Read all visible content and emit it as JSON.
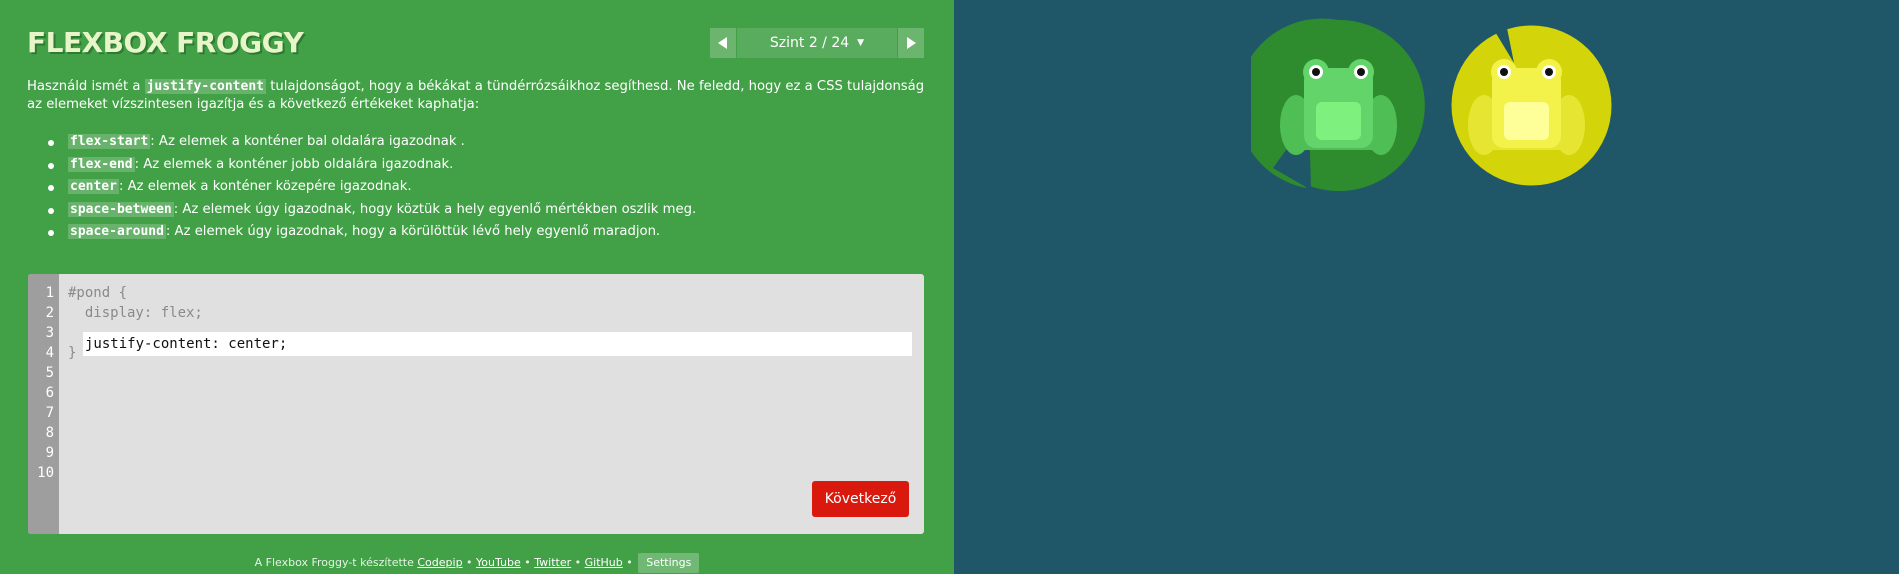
{
  "app": {
    "title": "FLEXBOX FROGGY"
  },
  "level_nav": {
    "label": "Szint 2 / 24",
    "prev_icon": "triangle-left-icon",
    "next_icon": "triangle-right-icon",
    "caret_icon": "caret-down-icon"
  },
  "instructions": {
    "intro_before": "Használd ismét a ",
    "intro_code": "justify-content",
    "intro_after": " tulajdonságot, hogy a békákat a tündérrózsáikhoz segíthesd. Ne feledd, hogy ez a CSS tulajdonság az elemeket vízszintesen igazítja és a következő értékeket kaphatja:",
    "options": [
      {
        "code": "flex-start",
        "text": ": Az elemek a konténer bal oldalára igazodnak ."
      },
      {
        "code": "flex-end",
        "text": ": Az elemek a konténer jobb oldalára igazodnak."
      },
      {
        "code": "center",
        "text": ": Az elemek a konténer közepére igazodnak."
      },
      {
        "code": "space-between",
        "text": ": Az elemek úgy igazodnak, hogy köztük a hely egyenlő mértékben oszlik meg."
      },
      {
        "code": "space-around",
        "text": ": Az elemek úgy igazodnak, hogy a körülöttük lévő hely egyenlő maradjon."
      }
    ]
  },
  "editor": {
    "line_numbers": [
      "1",
      "2",
      "3",
      "4",
      "5",
      "6",
      "7",
      "8",
      "9",
      "10"
    ],
    "line1": "#pond {",
    "line2": "  display: flex;",
    "input_value": "justify-content: center;",
    "line4": "}",
    "next_label": "Következő"
  },
  "credits": {
    "prefix": "A Flexbox Froggy-t készítette ",
    "links": [
      "Codepip",
      "YouTube",
      "Twitter",
      "GitHub"
    ],
    "separator": " • ",
    "settings_label": "Settings"
  },
  "pond": {
    "colors": {
      "background": "#1f5768",
      "green_pad": "#2e8b2e",
      "green_frog": "#63d46a",
      "yellow_pad": "#d4d40a",
      "yellow_frog": "#f2f24a"
    },
    "frogs": [
      "green",
      "yellow"
    ]
  }
}
